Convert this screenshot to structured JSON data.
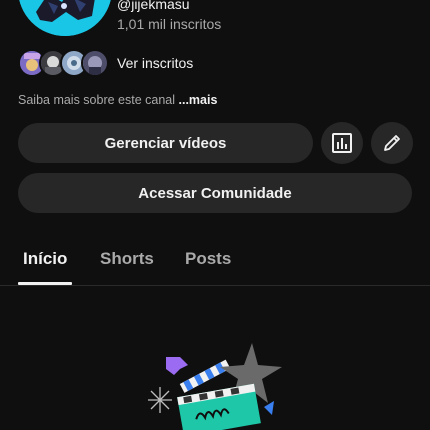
{
  "channel": {
    "handle": "@jijekmasu",
    "subscribers": "1,01 mil inscritos",
    "see_subscribers": "Ver inscritos",
    "about_text": "Saiba mais sobre este canal ",
    "about_more": "...mais"
  },
  "buttons": {
    "manage_videos": "Gerenciar vídeos",
    "access_community": "Acessar Comunidade",
    "stats_icon": "bar-chart-icon",
    "edit_icon": "pencil-icon"
  },
  "tabs": [
    {
      "label": "Início",
      "active": true
    },
    {
      "label": "Shorts",
      "active": false
    },
    {
      "label": "Posts",
      "active": false
    }
  ],
  "colors": {
    "background": "#0f0f0f",
    "button": "#272727",
    "avatar_bg": "#19c6e6",
    "illustration_teal": "#1fc7a9",
    "illustration_purple": "#9b6bf2"
  }
}
